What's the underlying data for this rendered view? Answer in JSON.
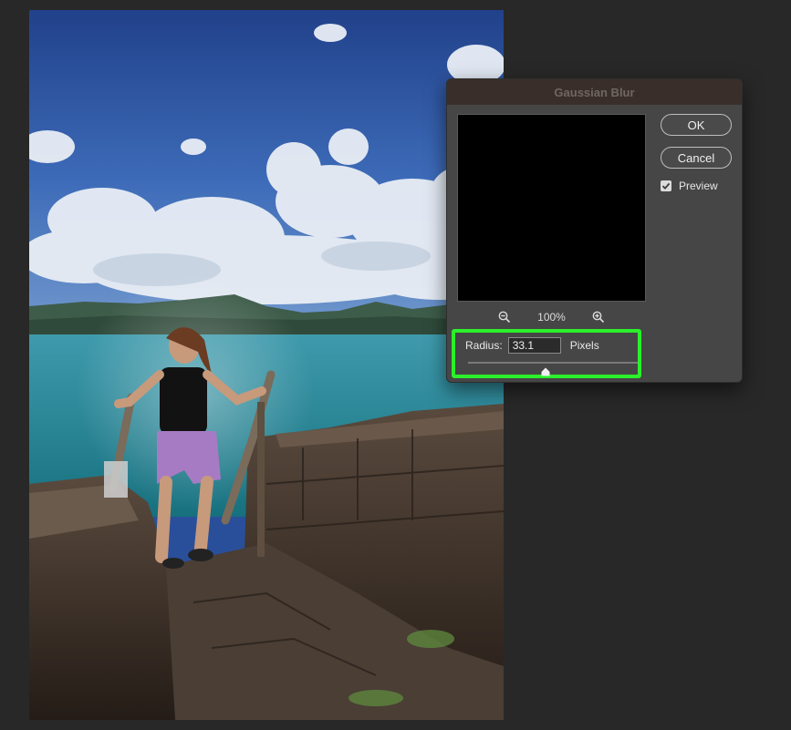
{
  "dialog": {
    "title": "Gaussian Blur",
    "ok_label": "OK",
    "cancel_label": "Cancel",
    "preview_label": "Preview",
    "preview_checked": true,
    "zoom_level": "100%",
    "radius_label": "Radius:",
    "radius_value": "33.1",
    "radius_unit": "Pixels",
    "radius_slider_fraction": 0.33,
    "highlight_color": "#2bf02b"
  },
  "icons": {
    "zoom_out": "zoom-out-icon",
    "zoom_in": "zoom-in-icon",
    "check": "checkmark-icon",
    "slider_thumb": "slider-thumb-icon"
  }
}
